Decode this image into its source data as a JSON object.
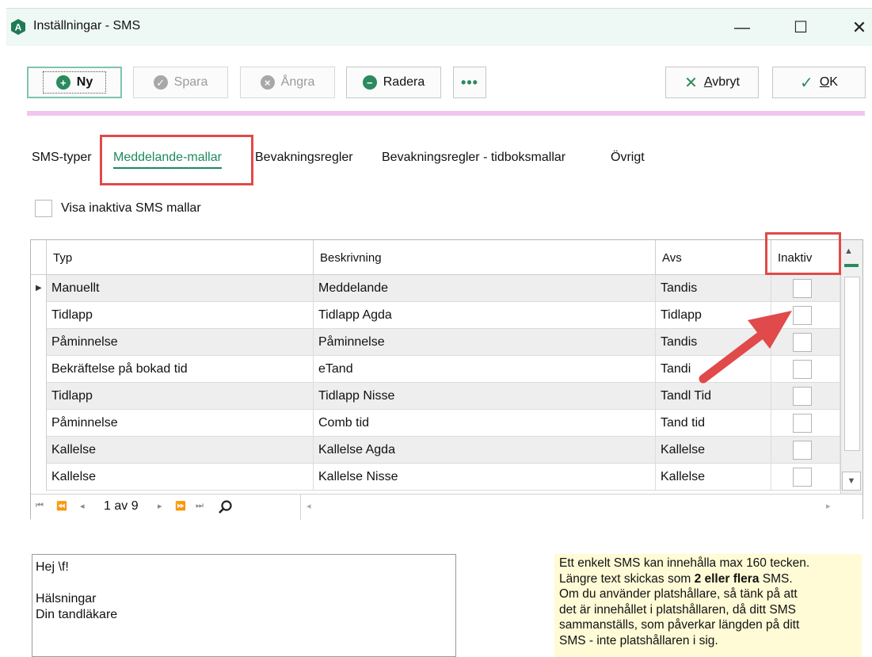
{
  "window": {
    "title": "Inställningar - SMS",
    "app_icon_letter": "A",
    "minimize_glyph": "—",
    "maximize_glyph": "☐",
    "close_glyph": "✕"
  },
  "toolbar": {
    "new_label": "Ny",
    "save_label": "Spara",
    "undo_label": "Ångra",
    "delete_label": "Radera",
    "more_label": "•••",
    "cancel_label_u": "A",
    "cancel_label_rest": "vbryt",
    "ok_label_u": "O",
    "ok_label_rest": "K"
  },
  "tabs": [
    {
      "label": "SMS-typer"
    },
    {
      "label": "Meddelande-mallar"
    },
    {
      "label": "Bevakningsregler"
    },
    {
      "label": "Bevakningsregler - tidboksmallar"
    },
    {
      "label": "Övrigt"
    }
  ],
  "show_inactive_label": "Visa inaktiva SMS mallar",
  "grid": {
    "columns": [
      "Typ",
      "Beskrivning",
      "Avs",
      "Inaktiv"
    ],
    "rows": [
      {
        "typ": "Manuellt",
        "beskrivning": "Meddelande",
        "avs": "Tandis"
      },
      {
        "typ": "Tidlapp",
        "beskrivning": "Tidlapp Agda",
        "avs": "Tidlapp"
      },
      {
        "typ": "Påminnelse",
        "beskrivning": "Påminnelse",
        "avs": "Tandis"
      },
      {
        "typ": "Bekräftelse på bokad tid",
        "beskrivning": "eTand",
        "avs": "Tandi"
      },
      {
        "typ": "Tidlapp",
        "beskrivning": "Tidlapp Nisse",
        "avs": "Tandl Tid"
      },
      {
        "typ": "Påminnelse",
        "beskrivning": "Comb tid",
        "avs": "Tand tid"
      },
      {
        "typ": "Kallelse",
        "beskrivning": "Kallelse Agda",
        "avs": "Kallelse"
      },
      {
        "typ": "Kallelse",
        "beskrivning": "Kallelse Nisse",
        "avs": "Kallelse"
      }
    ],
    "navigator": {
      "first": "⏮",
      "prev_page": "⏪",
      "prev": "◂",
      "page_text": "1 av 9",
      "next": "▸",
      "next_page": "⏩",
      "last": "⏭"
    }
  },
  "message": {
    "lines": [
      "Hej \\f!",
      "",
      "Hälsningar",
      "Din tandläkare"
    ]
  },
  "info": {
    "line1": "Ett enkelt SMS kan innehålla max 160 tecken.",
    "line2_pre": "Längre text skickas som ",
    "line2_bold": "2 eller flera",
    "line2_post": " SMS.",
    "line3": "Om du använder platshållare, så tänk på att",
    "line4": "det är innehållet i platshållaren, då ditt SMS",
    "line5": "sammanställs, som påverkar längden på ditt",
    "line6": "SMS - inte platshållaren i sig."
  },
  "colors": {
    "accent_green": "#1d8a5f",
    "highlight_red": "#e04a4a",
    "pink_separator": "#f0c6ef",
    "info_background": "#fefbd6"
  }
}
